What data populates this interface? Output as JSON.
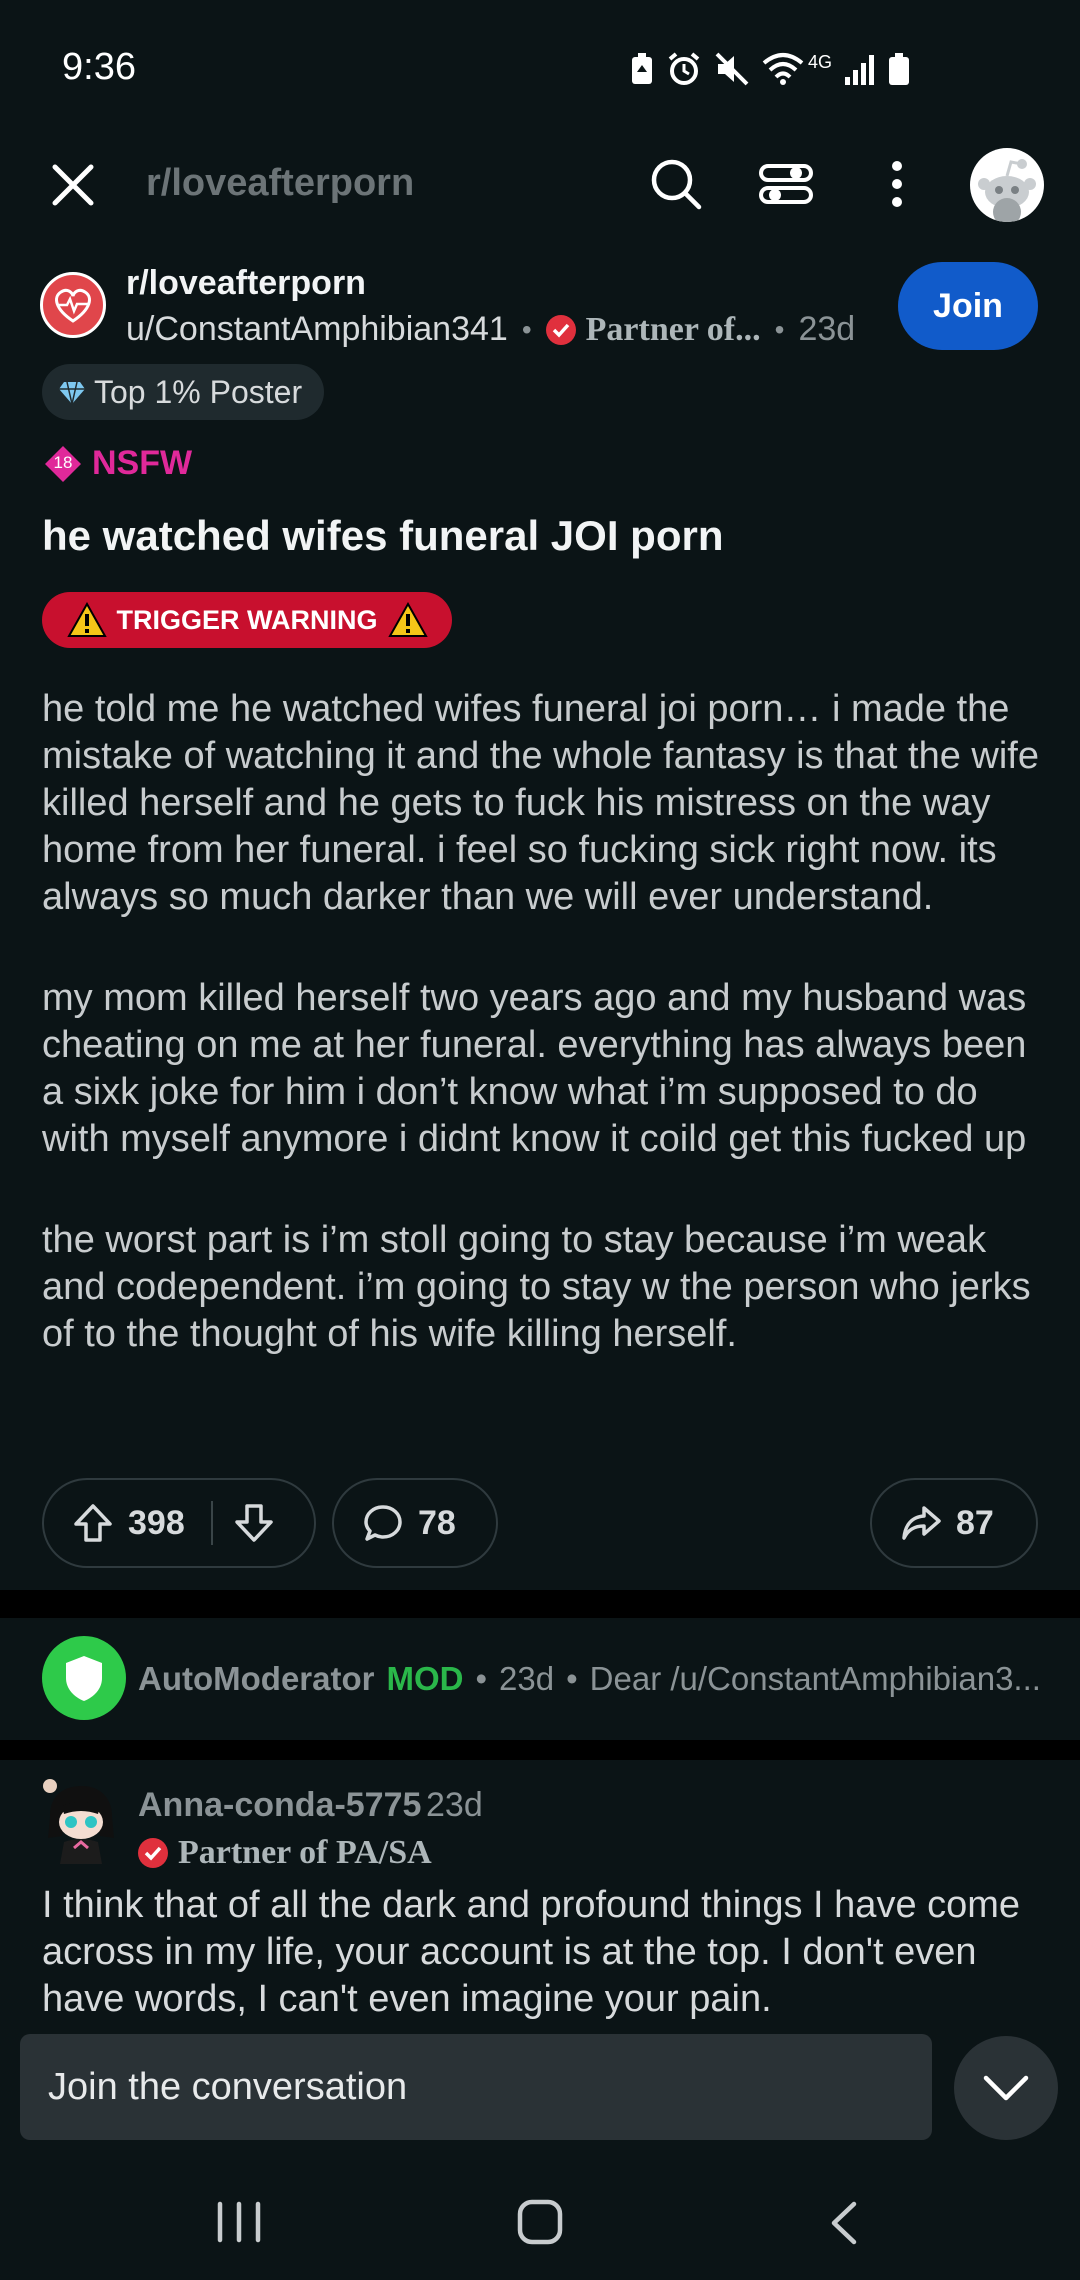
{
  "status_bar": {
    "time": "9:36",
    "network": "4G"
  },
  "top_nav": {
    "title": "r/loveafterporn"
  },
  "post": {
    "subreddit": "r/loveafterporn",
    "author": "u/ConstantAmphibian341",
    "author_flair": "Partner of...",
    "age": "23d",
    "join_label": "Join",
    "user_badge": "Top 1% Poster",
    "nsfw_label": "NSFW",
    "nsfw_badge": "18",
    "title": "he watched wifes funeral JOI porn",
    "flair_label": "TRIGGER WARNING",
    "paragraphs": [
      "he told me he watched wifes funeral joi porn… i made the mistake of watching it and the whole fantasy is that the wife killed herself and he gets to fuck his mistress on the way home from her funeral. i feel so fucking sick right now. its always so much darker than we will ever understand.",
      "my mom killed herself two years ago and my husband was cheating on me at her funeral. everything has always been a sixk joke for him i don’t know what i’m supposed to do with myself anymore i didnt know it coild get this fucked up",
      "the worst part is i’m stoll going to stay because i’m weak and codependent. i’m going to stay w the person who jerks of to the thought of his wife killing herself."
    ],
    "upvotes": "398",
    "comments": "78",
    "shares": "87"
  },
  "automod": {
    "name": "AutoModerator",
    "mod_label": "MOD",
    "age": "23d",
    "preview": "Dear /u/ConstantAmphibian3..."
  },
  "comment": {
    "author": "Anna-conda-5775",
    "age": "23d",
    "flair": "Partner of PA/SA",
    "text": "I think that of all the dark and profound things I have come across in my life, your account is at the top. I don't even have words, I can't even imagine your pain."
  },
  "composer": {
    "placeholder": "Join the conversation"
  },
  "colors": {
    "background": "#0b1416",
    "join_button": "#115bca",
    "nsfw": "#e0299a",
    "trigger_warning": "#c8102e",
    "mod_green": "#2ab74a"
  },
  "icons": [
    "close-icon",
    "search-icon",
    "filter-icon",
    "more-vertical-icon",
    "upvote-icon",
    "downvote-icon",
    "comment-icon",
    "share-icon",
    "chevron-down-icon",
    "warning-icon"
  ]
}
